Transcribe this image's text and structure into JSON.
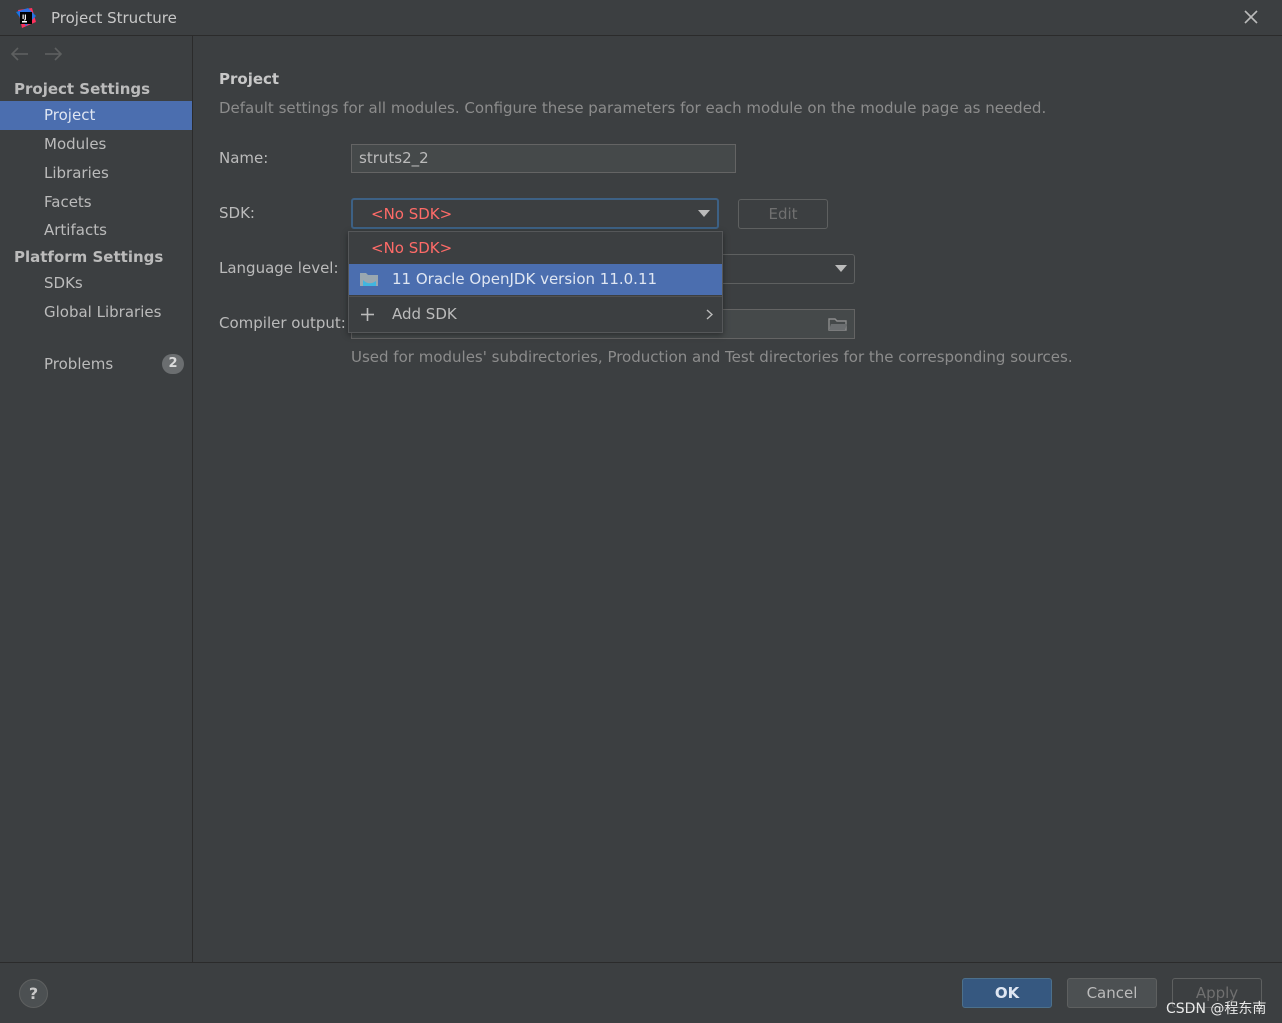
{
  "window": {
    "title": "Project Structure",
    "icons": {
      "app": "intellij-icon",
      "close": "close-icon"
    }
  },
  "nav": {
    "back_icon": "arrow-left-icon",
    "forward_icon": "arrow-right-icon"
  },
  "sidebar": {
    "project_settings_header": "Project Settings",
    "platform_settings_header": "Platform Settings",
    "items": {
      "project": "Project",
      "modules": "Modules",
      "libraries": "Libraries",
      "facets": "Facets",
      "artifacts": "Artifacts",
      "sdks": "SDKs",
      "global_libraries": "Global Libraries",
      "problems": "Problems"
    },
    "problems_count": "2",
    "selected": "project"
  },
  "main": {
    "title": "Project",
    "description": "Default settings for all modules. Configure these parameters for each module on the module page as needed.",
    "name_label": "Name:",
    "name_value": "struts2_2",
    "sdk_label": "SDK:",
    "sdk_value": "<No SDK>",
    "edit_label": "Edit",
    "language_level_label": "Language level:",
    "compiler_output_label": "Compiler output:",
    "compiler_output_help": "Used for modules' subdirectories, Production and Test directories for the corresponding sources."
  },
  "sdk_popup": {
    "items": {
      "no_sdk": "<No SDK>",
      "jdk": "11 Oracle OpenJDK version 11.0.11",
      "add_sdk": "Add SDK"
    },
    "selected": "jdk"
  },
  "footer": {
    "help": "?",
    "ok": "OK",
    "cancel": "Cancel",
    "apply": "Apply"
  },
  "watermark": "CSDN @程东南",
  "colors": {
    "background": "#3c3f41",
    "selection": "#4b6eaf",
    "error_red": "#ff6b68",
    "ok_button": "#365880"
  }
}
